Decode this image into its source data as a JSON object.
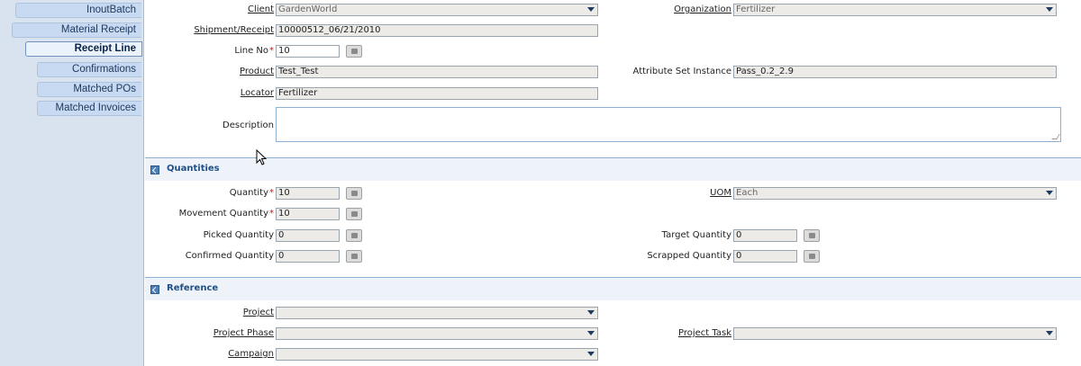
{
  "sidebar": {
    "tabs": [
      {
        "label": "InoutBatch"
      },
      {
        "label": "Material Receipt"
      },
      {
        "label": "Receipt Line"
      },
      {
        "label": "Confirmations"
      },
      {
        "label": "Matched POs"
      },
      {
        "label": "Matched Invoices"
      }
    ]
  },
  "form": {
    "client": {
      "label": "Client",
      "value": "GardenWorld"
    },
    "organization": {
      "label": "Organization",
      "value": "Fertilizer"
    },
    "shipment": {
      "label": "Shipment/Receipt",
      "value": "10000512_06/21/2010"
    },
    "line_no": {
      "label": "Line No",
      "value": "10"
    },
    "product": {
      "label": "Product",
      "value": "Test_Test"
    },
    "attribute_set": {
      "label": "Attribute Set Instance",
      "value": "Pass_0.2_2.9"
    },
    "locator": {
      "label": "Locator",
      "value": "Fertilizer"
    },
    "description": {
      "label": "Description",
      "value": ""
    }
  },
  "quantities": {
    "title": "Quantities",
    "quantity": {
      "label": "Quantity",
      "value": "10"
    },
    "uom": {
      "label": "UOM",
      "value": "Each"
    },
    "movement_quantity": {
      "label": "Movement Quantity",
      "value": "10"
    },
    "picked_quantity": {
      "label": "Picked Quantity",
      "value": "0"
    },
    "target_quantity": {
      "label": "Target Quantity",
      "value": "0"
    },
    "confirmed_quantity": {
      "label": "Confirmed Quantity",
      "value": "0"
    },
    "scrapped_quantity": {
      "label": "Scrapped Quantity",
      "value": "0"
    }
  },
  "reference": {
    "title": "Reference",
    "project": {
      "label": "Project",
      "value": ""
    },
    "project_phase": {
      "label": "Project Phase",
      "value": ""
    },
    "project_task": {
      "label": "Project Task",
      "value": ""
    },
    "campaign": {
      "label": "Campaign",
      "value": ""
    }
  },
  "required_marker": "*"
}
